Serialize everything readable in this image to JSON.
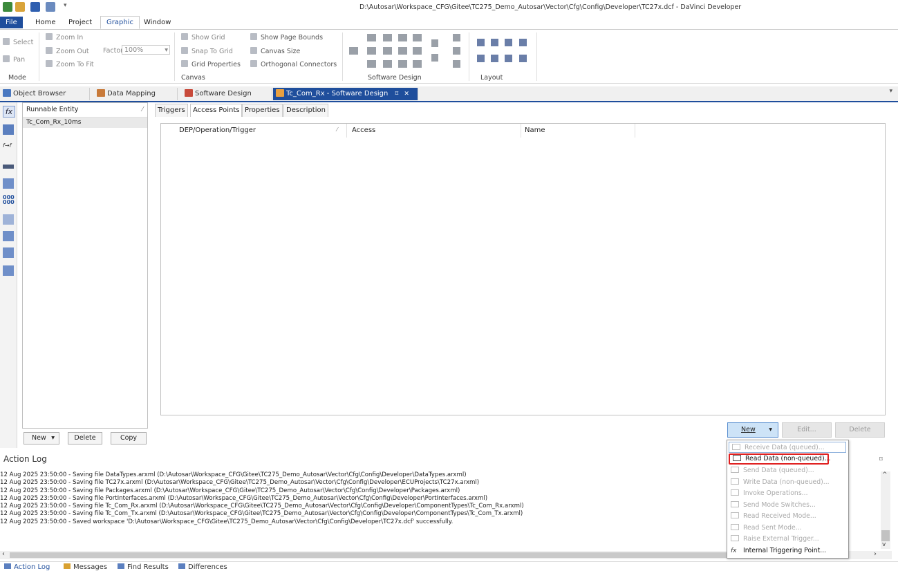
{
  "window": {
    "title": "D:\\Autosar\\Workspace_CFG\\Gitee\\TC275_Demo_Autosar\\Vector\\Cfg\\Config\\Developer\\TC27x.dcf - DaVinci Developer"
  },
  "ribbon_tabs": [
    "File",
    "Home",
    "Project",
    "Graphic",
    "Window"
  ],
  "ribbon": {
    "mode": {
      "select": "Select",
      "pan": "Pan",
      "label": "Mode"
    },
    "zoom": {
      "zoom_in": "Zoom In",
      "zoom_out": "Zoom Out",
      "zoom_to_fit": "Zoom To Fit",
      "factor_label": "Factor",
      "factor_value": "100%"
    },
    "canvas": {
      "show_grid": "Show Grid",
      "snap_to_grid": "Snap To Grid",
      "grid_properties": "Grid Properties",
      "show_page_bounds": "Show Page Bounds",
      "canvas_size": "Canvas Size",
      "orthogonal_connectors": "Orthogonal Connectors",
      "label": "Canvas"
    },
    "software_design_label": "Software Design",
    "layout_label": "Layout"
  },
  "doc_tabs": {
    "object_browser": "Object Browser",
    "data_mapping": "Data Mapping",
    "software_design": "Software Design",
    "active": "Tc_Com_Rx - Software Design",
    "pin": "⌑",
    "close": "✕"
  },
  "runnables": {
    "header": "Runnable Entity",
    "items": [
      "Tc_Com_Rx_10ms"
    ],
    "new_button": "New",
    "delete_button": "Delete",
    "copy_button": "Copy"
  },
  "inner_tabs": [
    "Triggers",
    "Access Points",
    "Properties",
    "Description"
  ],
  "access_grid": {
    "columns": [
      "DEP/Operation/Trigger",
      "Access",
      "Name"
    ]
  },
  "actions": {
    "new": "New",
    "edit": "Edit...",
    "delete": "Delete"
  },
  "new_menu": [
    {
      "label": "Receive Data (queued)...",
      "enabled": false
    },
    {
      "label": "Read Data (non-queued)...",
      "enabled": true,
      "highlighted": true
    },
    {
      "label": "Send Data (queued)...",
      "enabled": false
    },
    {
      "label": "Write Data (non-queued)...",
      "enabled": false
    },
    {
      "label": "Invoke Operations...",
      "enabled": false
    },
    {
      "label": "Send Mode Switches...",
      "enabled": false
    },
    {
      "label": "Read Received Mode...",
      "enabled": false
    },
    {
      "label": "Read Sent Mode...",
      "enabled": false
    },
    {
      "label": "Raise External Trigger...",
      "enabled": false
    },
    {
      "label": "Internal Triggering Point...",
      "enabled": true
    }
  ],
  "action_log": {
    "title": "Action Log",
    "lines": [
      "12 Aug 2025 23:50:00 - Saving file DataTypes.arxml (D:\\Autosar\\Workspace_CFG\\Gitee\\TC275_Demo_Autosar\\Vector\\Cfg\\Config\\Developer\\DataTypes.arxml)",
      "12 Aug 2025 23:50:00 - Saving file TC27x.arxml (D:\\Autosar\\Workspace_CFG\\Gitee\\TC275_Demo_Autosar\\Vector\\Cfg\\Config\\Developer\\ECUProjects\\TC27x.arxml)",
      "12 Aug 2025 23:50:00 - Saving file Packages.arxml (D:\\Autosar\\Workspace_CFG\\Gitee\\TC275_Demo_Autosar\\Vector\\Cfg\\Config\\Developer\\Packages.arxml)",
      "12 Aug 2025 23:50:00 - Saving file PortInterfaces.arxml (D:\\Autosar\\Workspace_CFG\\Gitee\\TC275_Demo_Autosar\\Vector\\Cfg\\Config\\Developer\\PortInterfaces.arxml)",
      "12 Aug 2025 23:50:00 - Saving file Tc_Com_Rx.arxml (D:\\Autosar\\Workspace_CFG\\Gitee\\TC275_Demo_Autosar\\Vector\\Cfg\\Config\\Developer\\ComponentTypes\\Tc_Com_Rx.arxml)",
      "12 Aug 2025 23:50:00 - Saving file Tc_Com_Tx.arxml (D:\\Autosar\\Workspace_CFG\\Gitee\\TC275_Demo_Autosar\\Vector\\Cfg\\Config\\Developer\\ComponentTypes\\Tc_Com_Tx.arxml)",
      "12 Aug 2025 23:50:00 - Saved workspace 'D:\\Autosar\\Workspace_CFG\\Gitee\\TC275_Demo_Autosar\\Vector\\Cfg\\Config\\Developer\\TC27x.dcf' successfully."
    ]
  },
  "bottom_tabs": [
    "Action Log",
    "Messages",
    "Find Results",
    "Differences"
  ],
  "colors": {
    "accent": "#1f4e9c",
    "highlight_box": "#e02020"
  }
}
